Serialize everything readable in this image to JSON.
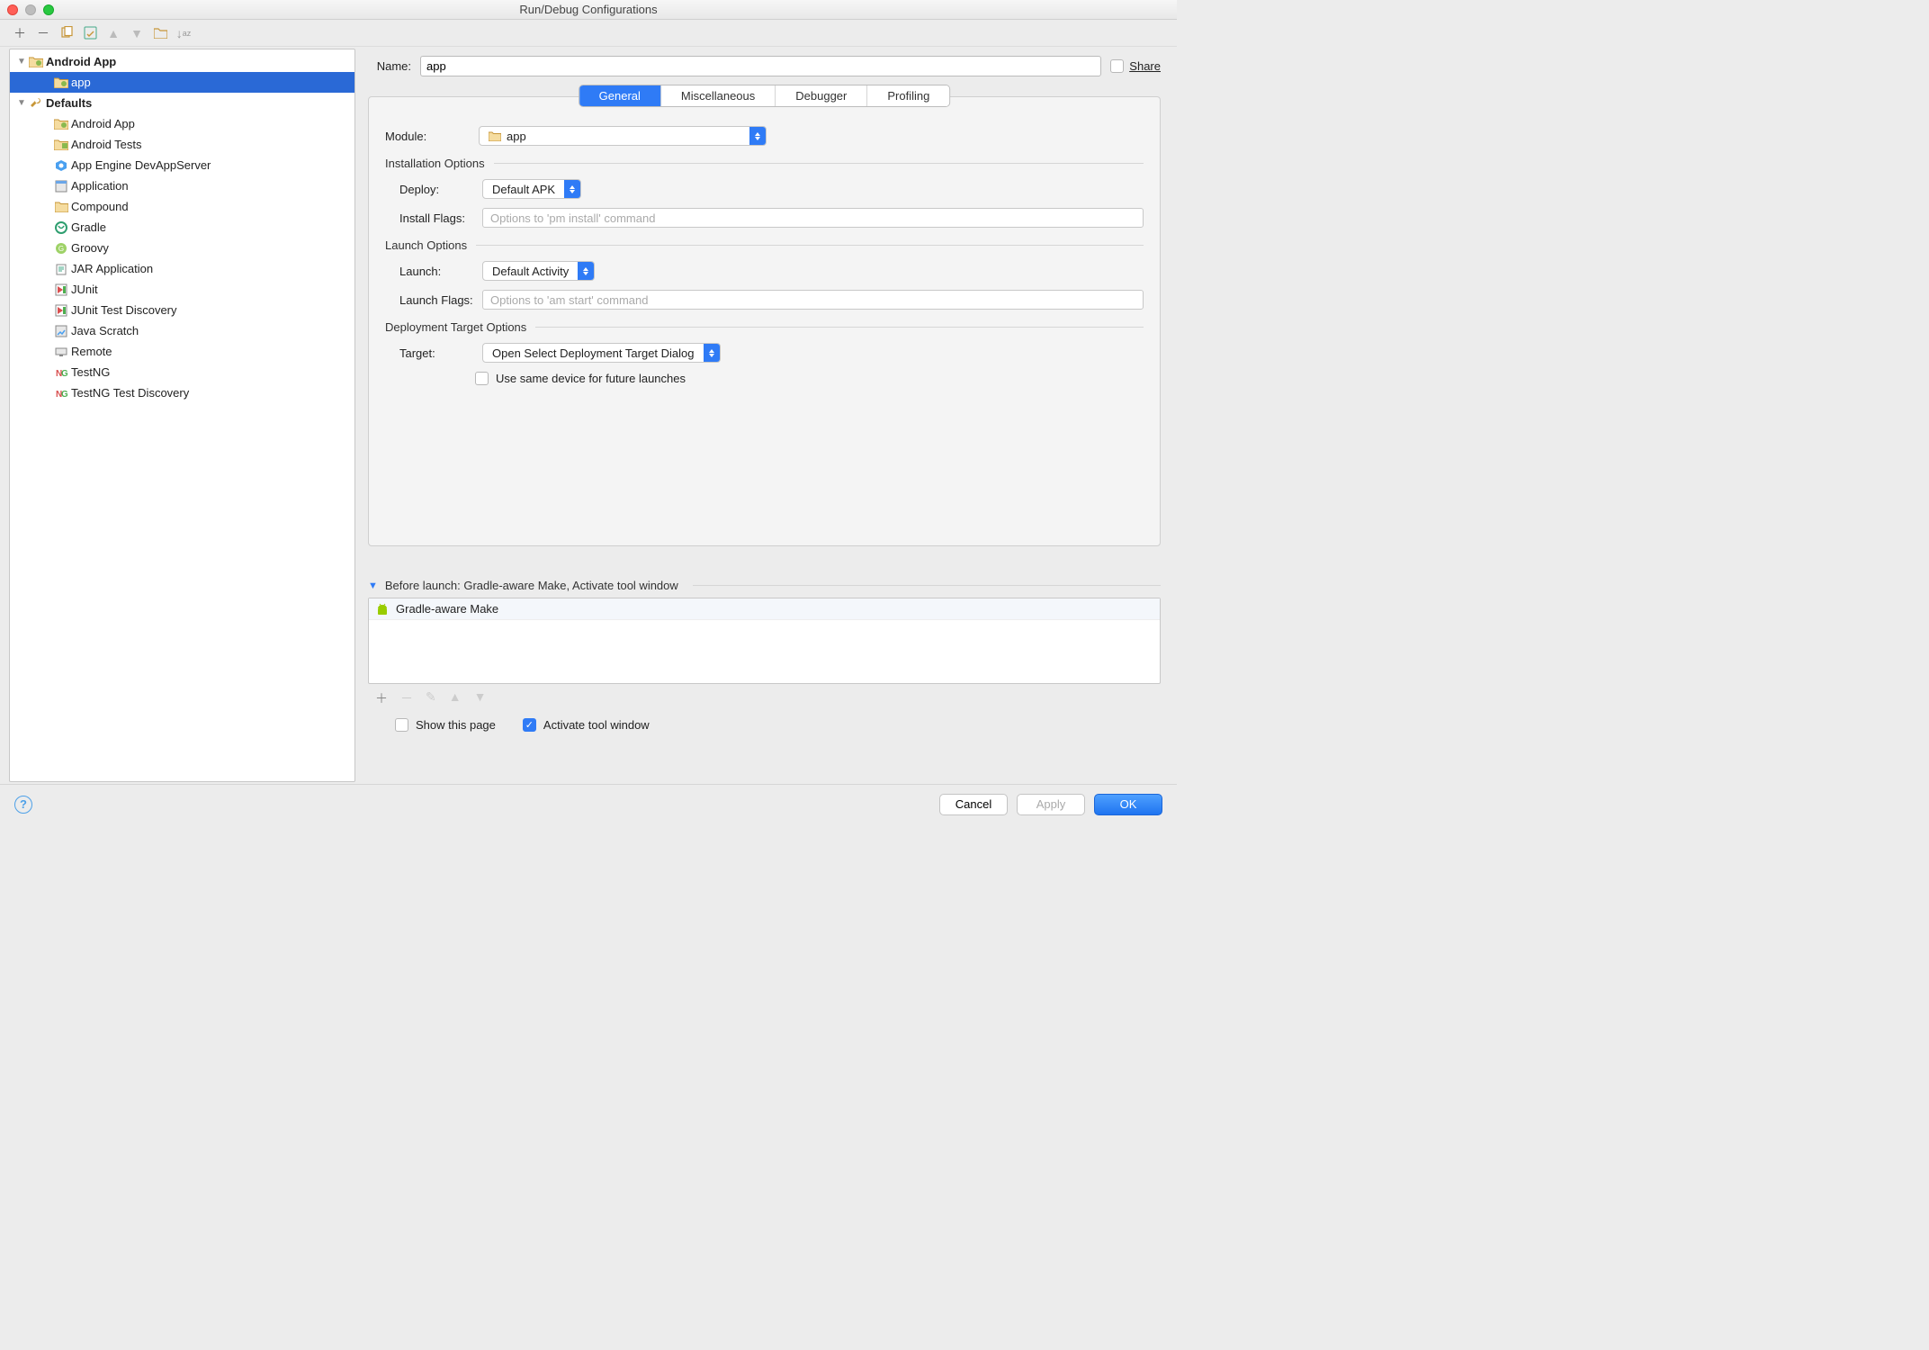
{
  "window": {
    "title": "Run/Debug Configurations"
  },
  "nameField": {
    "label": "Name:",
    "value": "app"
  },
  "share": {
    "label": "Share"
  },
  "tree": {
    "root": [
      {
        "label": "Android App",
        "bold": true,
        "icon": "android-folder"
      },
      {
        "label": "app",
        "selected": true,
        "indent": 2,
        "icon": "android-folder"
      },
      {
        "label": "Defaults",
        "bold": true,
        "icon": "wrench"
      }
    ],
    "defaults": [
      {
        "label": "Android App",
        "icon": "android-folder"
      },
      {
        "label": "Android Tests",
        "icon": "android-test"
      },
      {
        "label": "App Engine DevAppServer",
        "icon": "appengine"
      },
      {
        "label": "Application",
        "icon": "app"
      },
      {
        "label": "Compound",
        "icon": "folder"
      },
      {
        "label": "Gradle",
        "icon": "gradle"
      },
      {
        "label": "Groovy",
        "icon": "groovy"
      },
      {
        "label": "JAR Application",
        "icon": "jar"
      },
      {
        "label": "JUnit",
        "icon": "junit"
      },
      {
        "label": "JUnit Test Discovery",
        "icon": "junit"
      },
      {
        "label": "Java Scratch",
        "icon": "scratch"
      },
      {
        "label": "Remote",
        "icon": "remote"
      },
      {
        "label": "TestNG",
        "icon": "testng"
      },
      {
        "label": "TestNG Test Discovery",
        "icon": "testng"
      }
    ]
  },
  "tabs": [
    "General",
    "Miscellaneous",
    "Debugger",
    "Profiling"
  ],
  "activeTab": "General",
  "general": {
    "moduleLabel": "Module:",
    "moduleValue": "app",
    "installGroup": "Installation Options",
    "deployLabel": "Deploy:",
    "deployValue": "Default APK",
    "installFlagsLabel": "Install Flags:",
    "installFlagsPlaceholder": "Options to 'pm install' command",
    "launchGroup": "Launch Options",
    "launchLabel": "Launch:",
    "launchValue": "Default Activity",
    "launchFlagsLabel": "Launch Flags:",
    "launchFlagsPlaceholder": "Options to 'am start' command",
    "targetGroup": "Deployment Target Options",
    "targetLabel": "Target:",
    "targetValue": "Open Select Deployment Target Dialog",
    "useSameDevice": "Use same device for future launches"
  },
  "beforeLaunch": {
    "header": "Before launch: Gradle-aware Make, Activate tool window",
    "items": [
      "Gradle-aware Make"
    ],
    "showThisPage": "Show this page",
    "activateToolWindow": "Activate tool window"
  },
  "footer": {
    "cancel": "Cancel",
    "apply": "Apply",
    "ok": "OK"
  }
}
